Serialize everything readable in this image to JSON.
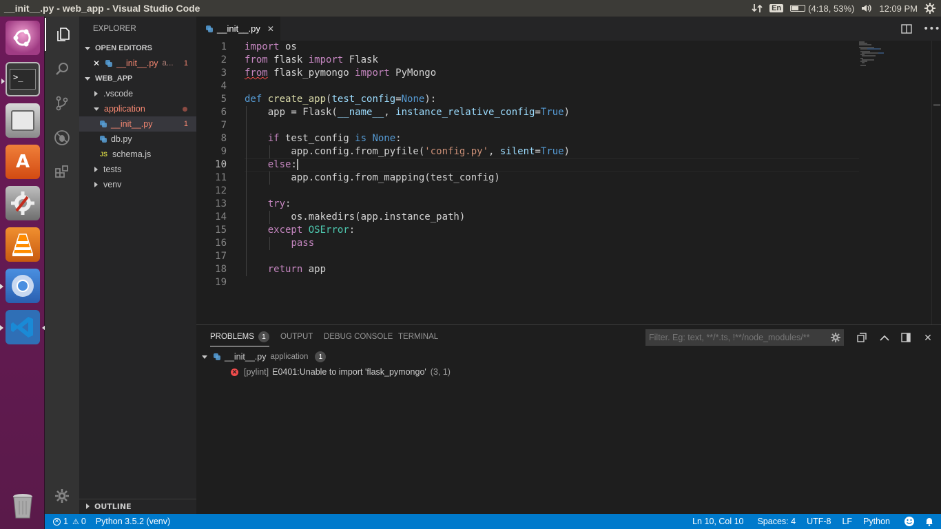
{
  "window": {
    "title": "__init__.py - web_app - Visual Studio Code"
  },
  "system_tray": {
    "language": "En",
    "battery": "(4:18, 53%)",
    "clock": "12:09 PM"
  },
  "sidebar": {
    "header": "EXPLORER",
    "open_editors": {
      "label": "OPEN EDITORS",
      "items": [
        {
          "name": "__init__.py",
          "folder": "a...",
          "problems": "1"
        }
      ]
    },
    "workspace": {
      "label": "WEB_APP",
      "tree": [
        {
          "name": ".vscode"
        },
        {
          "name": "application"
        },
        {
          "name": "__init__.py",
          "problems": "1"
        },
        {
          "name": "db.py"
        },
        {
          "name": "schema.js",
          "icon": "JS"
        },
        {
          "name": "tests"
        },
        {
          "name": "venv"
        }
      ]
    },
    "outline_label": "OUTLINE"
  },
  "tab": {
    "label": "__init__.py"
  },
  "editor": {
    "line_numbers": [
      "1",
      "2",
      "3",
      "4",
      "5",
      "6",
      "7",
      "8",
      "9",
      "10",
      "11",
      "12",
      "13",
      "14",
      "15",
      "16",
      "17",
      "18",
      "19"
    ],
    "current_line": 10
  },
  "panel": {
    "tabs": {
      "problems": "PROBLEMS",
      "problems_count": "1",
      "output": "OUTPUT",
      "debug": "DEBUG CONSOLE",
      "terminal": "TERMINAL"
    },
    "filter_placeholder": "Filter. Eg: text, **/*.ts, !**/node_modules/**",
    "file": {
      "name": "__init__.py",
      "folder": "application",
      "count": "1"
    },
    "problem": {
      "source": "[pylint]",
      "message": "E0401:Unable to import 'flask_pymongo'",
      "location": "(3, 1)"
    }
  },
  "statusbar": {
    "errors": "1",
    "warnings": "0",
    "interpreter": "Python 3.5.2 (venv)",
    "position": "Ln 10, Col 10",
    "spaces": "Spaces: 4",
    "encoding": "UTF-8",
    "eol": "LF",
    "language": "Python"
  },
  "colors": {
    "accent": "#007acc",
    "error": "#f14c4c",
    "launcher": "#6c1a59"
  }
}
